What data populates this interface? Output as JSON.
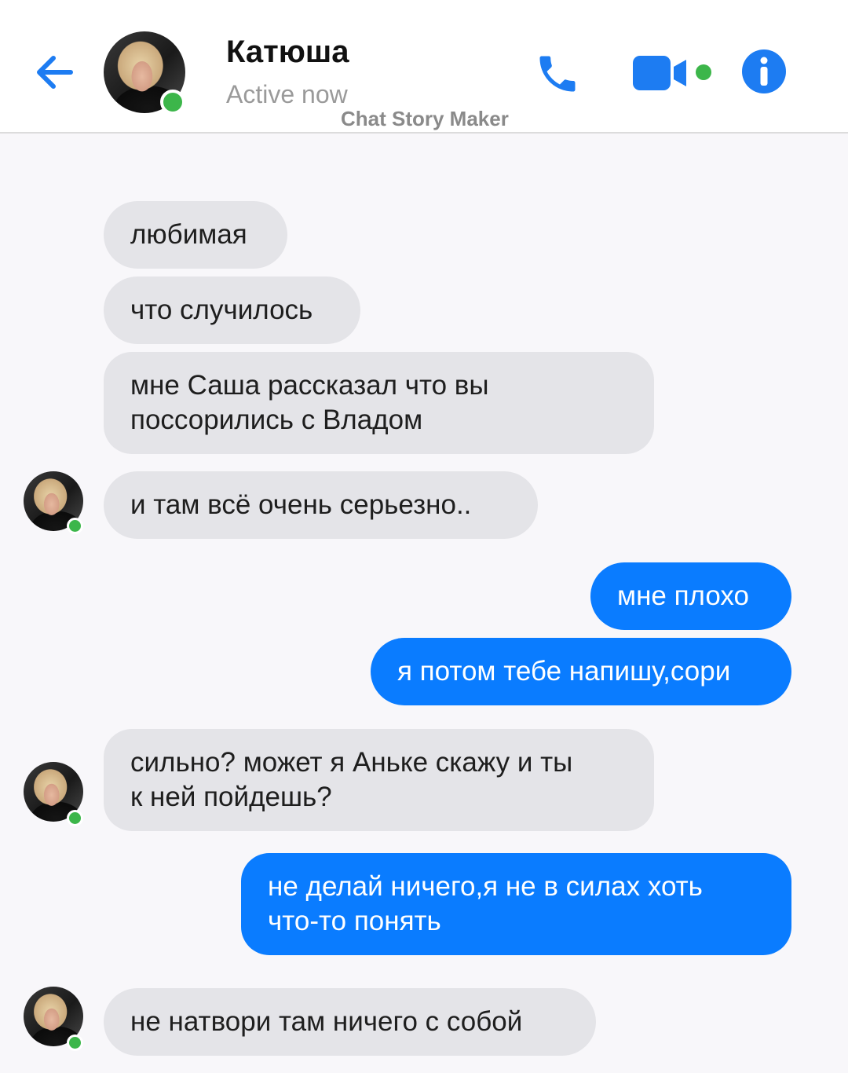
{
  "header": {
    "contact_name": "Катюша",
    "status": "Active now",
    "watermark": "Chat Story Maker",
    "accent_color": "#0a7cff",
    "online_color": "#3cb64a",
    "icons": [
      "back-arrow-icon",
      "phone-icon",
      "video-camera-icon",
      "info-icon"
    ]
  },
  "messages": [
    {
      "from": "contact",
      "text": "любимая",
      "text2": ""
    },
    {
      "from": "contact",
      "text": "что случилось",
      "text2": ""
    },
    {
      "from": "contact",
      "text": "мне Саша рассказал что вы",
      "text2": "поссорились с Владом"
    },
    {
      "from": "contact",
      "text": "и там всё очень серьезно..",
      "text2": ""
    },
    {
      "from": "me",
      "text": "мне плохо",
      "text2": ""
    },
    {
      "from": "me",
      "text": "я потом тебе напишу,сори",
      "text2": ""
    },
    {
      "from": "contact",
      "text": "сильно? может я Аньке скажу и ты",
      "text2": "к ней пойдешь?"
    },
    {
      "from": "me",
      "text": "не делай ничего,я не в силах хоть",
      "text2": "что-то понять"
    },
    {
      "from": "contact",
      "text": "не натвори там ничего с собой",
      "text2": ""
    }
  ]
}
